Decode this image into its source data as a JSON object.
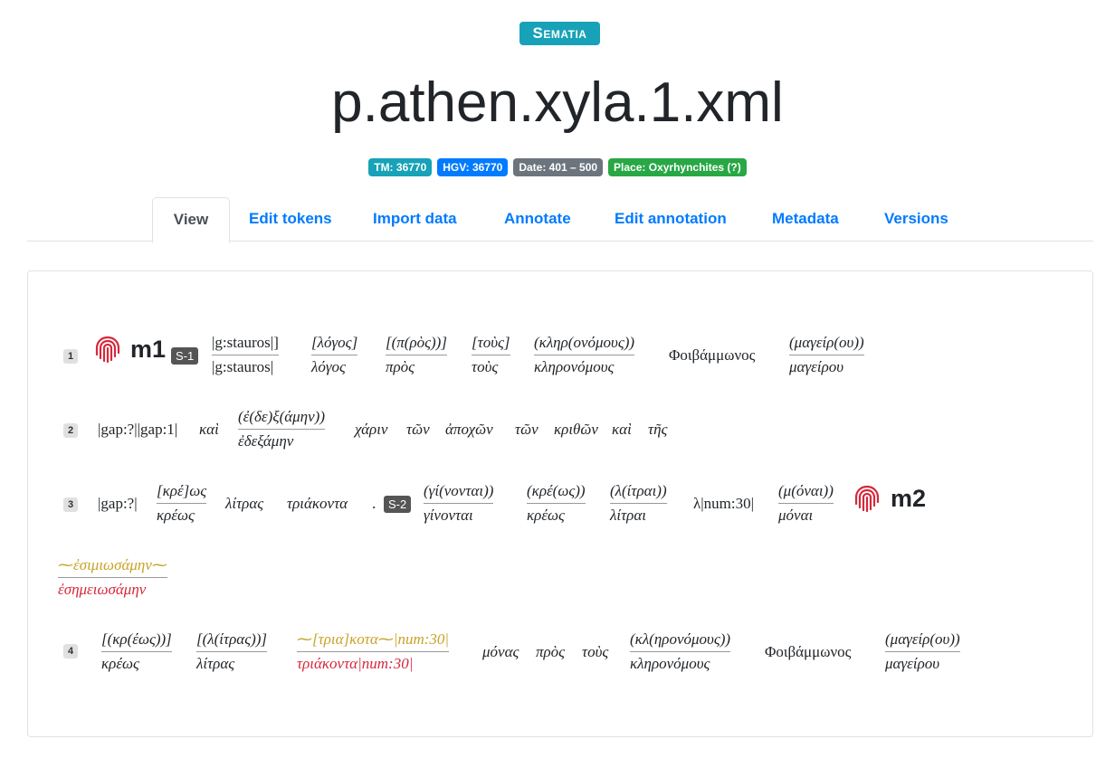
{
  "brand": "Sematia",
  "title": "p.athen.xyla.1.xml",
  "badges": {
    "tm": "TM: 36770",
    "hgv": "HGV: 36770",
    "date": "Date: 401 – 500",
    "place": "Place: Oxyrhynchites (?)"
  },
  "tabs": [
    "View",
    "Edit tokens",
    "Import data",
    "Annotate",
    "Edit annotation",
    "Metadata",
    "Versions"
  ],
  "icons": {
    "hand": "fingerprint-icon"
  },
  "lines": {
    "l1": {
      "num": "1",
      "hand": "m1",
      "section": "S-1",
      "t1_top": "|g:stauros|]",
      "t1_bot": "|g:stauros|",
      "t2_top": "[λόγος]",
      "t2_bot": "λόγος",
      "t3_top": "[(π(ρὸς))]",
      "t3_bot": "πρὸς",
      "t4_top": "[τοὺς]",
      "t4_bot": "τοὺς",
      "t5_top": "(κληρ(ονόμους))",
      "t5_bot": "κληρονόμους",
      "t6": "Φοιβάμμωνος",
      "t7_top": "(μαγείρ(ου))",
      "t7_bot": "μαγείρου"
    },
    "l2": {
      "num": "2",
      "t1": "|gap:?||gap:1|",
      "t2": "καὶ",
      "t3_top": "(ἐ(δε)ξ(άμην))",
      "t3_bot": "ἐδεξάμην",
      "t4": "χάριν",
      "t5": "τῶν",
      "t6": "ἀποχῶν",
      "t7": "τῶν",
      "t8": "κριθῶν",
      "t9": "καὶ",
      "t10": "τῆς"
    },
    "l3": {
      "num": "3",
      "t1": "|gap:?|",
      "t2_top": "[κρέ]ως",
      "t2_bot": "κρέως",
      "t3": "λίτρας",
      "t4": "τριάκοντα",
      "t5": ".",
      "section": "S-2",
      "t6_top": "(γί(νονται))",
      "t6_bot": "γίνονται",
      "t7_top": "(κρέ(ως))",
      "t7_bot": "κρέως",
      "t8_top": "(λ(ίτραι))",
      "t8_bot": "λίτραι",
      "t9": "λ|num:30|",
      "t10_top": "(μ(όναι))",
      "t10_bot": "μόναι",
      "hand": "m2"
    },
    "sub": {
      "top": "⁓ἐσιμιωσάμην⁓",
      "bot": "ἐσημειωσάμην"
    },
    "l4": {
      "num": "4",
      "t1_top": "[(κρ(έως))]",
      "t1_bot": "κρέως",
      "t2_top": "[(λ(ίτρας))]",
      "t2_bot": "λίτρας",
      "t3_top": "⁓[τρια]κοτα⁓|num:30|",
      "t3_bot": "τριάκοντα|num:30|",
      "t4": "μόνας",
      "t5": "πρὸς",
      "t6": "τοὺς",
      "t7_top": "(κλ(ηρονόμους))",
      "t7_bot": "κληρονόμους",
      "t8": "Φοιβάμμωνος",
      "t9_top": "(μαγείρ(ου))",
      "t9_bot": "μαγείρου"
    }
  }
}
